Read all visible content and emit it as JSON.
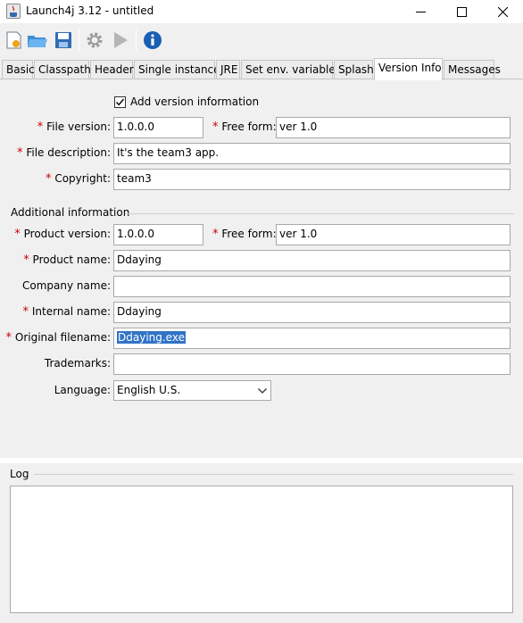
{
  "window": {
    "title": "Launch4j 3.12 - untitled",
    "min_glyph": "—",
    "max_glyph": "☐",
    "close_glyph": "✕"
  },
  "toolbar": {
    "icons": [
      "new-file-icon",
      "open-folder-icon",
      "save-icon",
      "build-gear-icon",
      "run-icon",
      "info-icon"
    ]
  },
  "tabs": [
    {
      "label": "Basic",
      "active": false
    },
    {
      "label": "Classpath",
      "active": false
    },
    {
      "label": "Header",
      "active": false
    },
    {
      "label": "Single instance",
      "active": false
    },
    {
      "label": "JRE",
      "active": false
    },
    {
      "label": "Set env. variables",
      "active": false
    },
    {
      "label": "Splash",
      "active": false
    },
    {
      "label": "Version Info",
      "active": true
    },
    {
      "label": "Messages",
      "active": false
    }
  ],
  "version_info": {
    "add_version_label": "Add version information",
    "add_version_checked": true,
    "file_version_label": "File version:",
    "file_version_value": "1.0.0.0",
    "free_form_label": "Free form:",
    "free_form_value": "ver 1.0",
    "file_description_label": "File description:",
    "file_description_value": "It's the team3 app.",
    "copyright_label": "Copyright:",
    "copyright_value": "team3",
    "additional_info_heading": "Additional information",
    "product_version_label": "Product version:",
    "product_version_value": "1.0.0.0",
    "product_free_form_label": "Free form:",
    "product_free_form_value": "ver 1.0",
    "product_name_label": "Product name:",
    "product_name_value": "Ddaying",
    "company_name_label": "Company name:",
    "company_name_value": "",
    "internal_name_label": "Internal name:",
    "internal_name_value": "Ddaying",
    "original_filename_label": "Original filename:",
    "original_filename_value": "Ddaying.exe",
    "trademarks_label": "Trademarks:",
    "trademarks_value": "",
    "language_label": "Language:",
    "language_value": "English U.S.",
    "required_marker": "*"
  },
  "log": {
    "heading": "Log",
    "content": ""
  },
  "colors": {
    "required_star": "#cc0000",
    "selection": "#3173c6",
    "info_blue": "#1a5fb4"
  }
}
